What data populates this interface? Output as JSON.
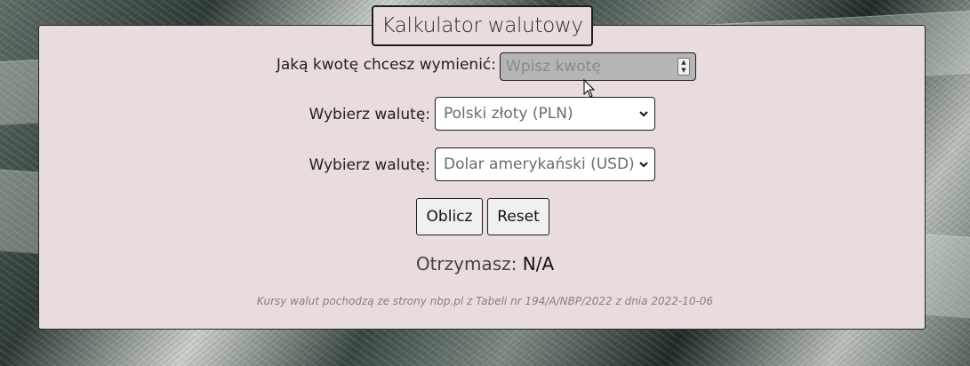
{
  "title": "Kalkulator walutowy",
  "amount": {
    "label": "Jaką kwotę chcesz wymienić:",
    "placeholder": "Wpisz kwotę",
    "value": ""
  },
  "from_currency": {
    "label": "Wybierz walutę:",
    "selected": "Polski złoty (PLN)"
  },
  "to_currency": {
    "label": "Wybierz walutę:",
    "selected": "Dolar amerykański (USD)"
  },
  "buttons": {
    "calculate": "Oblicz",
    "reset": "Reset"
  },
  "result": {
    "label": "Otrzymasz:",
    "value": "N/A"
  },
  "footnote": "Kursy walut pochodzą ze strony nbp.pl z Tabeli nr 194/A/NBP/2022 z dnia 2022-10-06",
  "colors": {
    "card_background": "#e8dcdc",
    "input_background": "#b5b5b5",
    "border": "#1e1e1e"
  }
}
